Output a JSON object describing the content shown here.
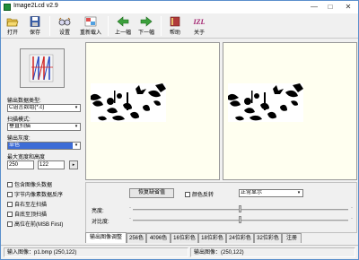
{
  "window": {
    "title": "Image2Lcd v2.9",
    "minimize_glyph": "—",
    "maximize_glyph": "□",
    "close_glyph": "✕"
  },
  "toolbar": {
    "buttons": [
      {
        "label": "打开",
        "icon": "open-folder-icon"
      },
      {
        "label": "保存",
        "icon": "save-disk-icon"
      },
      {
        "label": "设置",
        "icon": "settings-glasses-icon"
      },
      {
        "label": "重新载入",
        "icon": "reload-icon"
      },
      {
        "label": "上一幅",
        "icon": "arrow-left-icon"
      },
      {
        "label": "下一幅",
        "icon": "arrow-right-icon"
      },
      {
        "label": "帮助",
        "icon": "help-book-icon"
      },
      {
        "label": "关于",
        "icon": "about-izl-icon"
      }
    ],
    "about_icon_text": "IZL"
  },
  "left": {
    "output_type_label": "输出数据类型:",
    "output_type_value": "C语言数组(*.c)",
    "scan_mode_label": "扫描模式:",
    "scan_mode_value": "垂直扫描",
    "output_gray_label": "输出灰度:",
    "output_gray_value": "单色",
    "max_size_label": "最大宽度和高度",
    "width_value": "250",
    "height_value": "122",
    "size_button_glyph": "▸",
    "dropdown_glyph": "▾",
    "checkboxes": [
      {
        "label": "包含图像头数据",
        "checked": false
      },
      {
        "label": "字节内像素数据反序",
        "checked": false
      },
      {
        "label": "自右至左扫描",
        "checked": false
      },
      {
        "label": "自底至顶扫描",
        "checked": false
      },
      {
        "label": "高位在前(MSB First)",
        "checked": false
      }
    ]
  },
  "settings": {
    "restore_button": "恢复缺省值",
    "invert_label": "颜色反转",
    "display_mode": "正常显示",
    "brightness_label": "亮度:",
    "contrast_label": "对比度:",
    "brightness_level": 0.5,
    "contrast_level": 0.5,
    "slider_dot": "·"
  },
  "tabs": [
    "输出图像调整",
    "256色",
    "4096色",
    "16位彩色",
    "18位彩色",
    "24位彩色",
    "32位彩色",
    "注册"
  ],
  "status": {
    "input": "输入图像：p1.bmp (250,122)",
    "output": "输出图像：(250,122)"
  }
}
